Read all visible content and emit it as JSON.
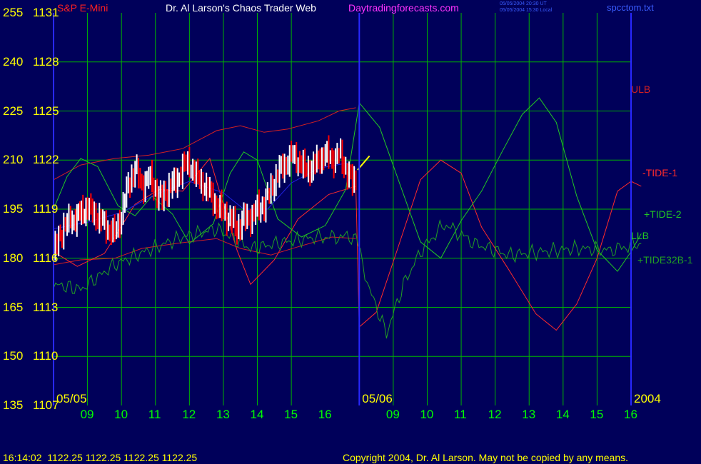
{
  "header": {
    "instrument": "S&P E-Mini",
    "title": "Dr. Al Larson's Chaos Trader Web",
    "website": "Daytradingforecasts.com",
    "stamp_ut": "05/05/2004 20:30 UT",
    "stamp_local": "05/05/2004 15:30 Local",
    "file": "spcctom.txt"
  },
  "colors": {
    "background": "#00005a",
    "grid": "#00b400",
    "axis": "#2828ff",
    "price_up": "#ffffff",
    "price_down": "#ff0000",
    "ulb_llb": "#d42020",
    "tide1": "#ff2a2a",
    "tide2": "#22c822",
    "tide32b1": "#22a022",
    "moving_avg": "#2020e0",
    "axis_text": "#ffff00",
    "date_text": "#00ff00",
    "title_text": "#ffffff",
    "website_text": "#ff33ff"
  },
  "footer": {
    "quote": "16:14:02  1122.25 1122.25 1122.25 1122.25",
    "copyright": "Copyright 2004, Dr. Al Larson. May not be copied by any means."
  },
  "chart_data": {
    "type": "line",
    "title": "Dr. Al Larson's Chaos Trader Web",
    "y_left_labels": [
      "255",
      "240",
      "225",
      "210",
      "195",
      "180",
      "165",
      "150",
      "135"
    ],
    "y_price_labels": [
      "1131",
      "1128",
      "1125",
      "1122",
      "1119",
      "1116",
      "1113",
      "1110",
      "1107"
    ],
    "ylim": [
      1107,
      1131
    ],
    "x_date_labels": [
      {
        "label": "05/05",
        "at": 7
      },
      {
        "label": "05/06",
        "at": 16
      },
      {
        "label": "2004",
        "at": 24
      }
    ],
    "x_ticks": [
      "09",
      "10",
      "11",
      "12",
      "13",
      "14",
      "15",
      "16",
      "09",
      "10",
      "11",
      "12",
      "13",
      "14",
      "15",
      "16"
    ],
    "xlim": [
      7,
      24
    ],
    "series": [
      {
        "name": "ULB",
        "role": "band",
        "points": [
          [
            7,
            1120.8
          ],
          [
            7.8,
            1121.7
          ],
          [
            8.8,
            1122.1
          ],
          [
            9.8,
            1122.3
          ],
          [
            10.8,
            1122.7
          ],
          [
            11.8,
            1123.8
          ],
          [
            12.5,
            1124.1
          ],
          [
            13.2,
            1123.7
          ],
          [
            13.9,
            1123.9
          ],
          [
            14.8,
            1124.4
          ],
          [
            15.4,
            1125.0
          ],
          [
            15.9,
            1125.2
          ]
        ]
      },
      {
        "name": "LLB",
        "role": "band",
        "points": [
          [
            7,
            1115.6
          ],
          [
            7.8,
            1115.9
          ],
          [
            8.8,
            1116.0
          ],
          [
            9.6,
            1116.6
          ],
          [
            10.6,
            1116.9
          ],
          [
            11.8,
            1117.2
          ],
          [
            12.5,
            1116.6
          ],
          [
            13.4,
            1116.2
          ],
          [
            14.2,
            1116.7
          ],
          [
            15.2,
            1117.3
          ],
          [
            15.9,
            1117.2
          ]
        ]
      },
      {
        "name": "-TIDE-1",
        "role": "cycle",
        "points": [
          [
            7,
            1116.4
          ],
          [
            7.7,
            1115.5
          ],
          [
            8.5,
            1116.3
          ],
          [
            9.4,
            1119.3
          ],
          [
            10.1,
            1120.2
          ],
          [
            10.8,
            1120.1
          ],
          [
            11.6,
            1122.1
          ],
          [
            12.4,
            1116.5
          ],
          [
            12.8,
            1114.4
          ],
          [
            13.5,
            1115.9
          ],
          [
            14.2,
            1118.4
          ],
          [
            15.1,
            1119.9
          ],
          [
            15.9,
            1120.4
          ],
          [
            16.0,
            1111.8
          ],
          [
            16.5,
            1112.7
          ],
          [
            17.1,
            1116.4
          ],
          [
            17.8,
            1120.8
          ],
          [
            18.4,
            1122.0
          ],
          [
            19.0,
            1121.2
          ],
          [
            19.6,
            1117.9
          ],
          [
            20.4,
            1115.3
          ],
          [
            21.2,
            1112.6
          ],
          [
            21.8,
            1111.6
          ],
          [
            22.4,
            1113.2
          ],
          [
            23.0,
            1116.0
          ],
          [
            23.6,
            1120.1
          ],
          [
            24.0,
            1120.7
          ],
          [
            24.3,
            1120.4
          ]
        ]
      },
      {
        "name": "+TIDE-2",
        "role": "cycle",
        "points": [
          [
            7,
            1119.0
          ],
          [
            7.4,
            1121.0
          ],
          [
            7.8,
            1122.1
          ],
          [
            8.3,
            1121.6
          ],
          [
            8.9,
            1119.2
          ],
          [
            9.4,
            1118.6
          ],
          [
            9.9,
            1119.8
          ],
          [
            10.5,
            1118.7
          ],
          [
            11.0,
            1116.9
          ],
          [
            11.7,
            1118.1
          ],
          [
            12.2,
            1121.2
          ],
          [
            12.6,
            1122.5
          ],
          [
            13.0,
            1122.0
          ],
          [
            13.6,
            1118.4
          ],
          [
            14.3,
            1117.3
          ],
          [
            15.0,
            1118.0
          ],
          [
            15.6,
            1120.2
          ],
          [
            16.0,
            1125.5
          ],
          [
            16.6,
            1124.0
          ],
          [
            17.2,
            1120.5
          ],
          [
            17.8,
            1117.0
          ],
          [
            18.4,
            1116.0
          ],
          [
            19.0,
            1118.3
          ],
          [
            19.6,
            1120.1
          ],
          [
            20.2,
            1122.5
          ],
          [
            20.8,
            1124.8
          ],
          [
            21.3,
            1125.8
          ],
          [
            21.8,
            1124.3
          ],
          [
            22.4,
            1119.8
          ],
          [
            23.0,
            1116.5
          ],
          [
            23.6,
            1115.2
          ],
          [
            24.0,
            1116.4
          ],
          [
            24.3,
            1117.5
          ]
        ]
      },
      {
        "name": "+TIDE32B-1",
        "role": "cycle",
        "points": [
          [
            7,
            1114.4
          ],
          [
            7.8,
            1114.1
          ],
          [
            8.8,
            1115.6
          ],
          [
            9.8,
            1116.5
          ],
          [
            10.8,
            1117.3
          ],
          [
            11.8,
            1117.8
          ],
          [
            12.8,
            1116.6
          ],
          [
            13.8,
            1117.0
          ],
          [
            14.8,
            1117.3
          ],
          [
            15.9,
            1117.3
          ],
          [
            16.3,
            1114.1
          ],
          [
            16.8,
            1111.4
          ],
          [
            17.3,
            1114.4
          ],
          [
            17.8,
            1116.4
          ],
          [
            18.5,
            1118.1
          ],
          [
            19.4,
            1116.9
          ],
          [
            20.4,
            1116.2
          ],
          [
            21.4,
            1116.4
          ],
          [
            22.4,
            1116.6
          ],
          [
            23.4,
            1116.5
          ],
          [
            24.3,
            1116.9
          ]
        ]
      },
      {
        "name": "",
        "role": "moving-average",
        "points": [
          [
            7,
            1117.8
          ],
          [
            8.0,
            1118.2
          ],
          [
            9.0,
            1118.8
          ],
          [
            10.0,
            1119.9
          ],
          [
            11.0,
            1120.7
          ],
          [
            12.0,
            1120.0
          ],
          [
            12.6,
            1119.0
          ],
          [
            13.3,
            1119.0
          ],
          [
            14.0,
            1120.6
          ],
          [
            14.8,
            1121.5
          ],
          [
            15.6,
            1121.8
          ],
          [
            15.9,
            1121.5
          ]
        ]
      },
      {
        "name": "",
        "role": "price-close",
        "points": [
          [
            7,
            1116.3
          ],
          [
            7.3,
            1118.0
          ],
          [
            7.6,
            1118.4
          ],
          [
            8.0,
            1119.1
          ],
          [
            8.3,
            1118.5
          ],
          [
            8.6,
            1117.8
          ],
          [
            8.8,
            1117.5
          ],
          [
            9.0,
            1118.7
          ],
          [
            9.2,
            1120.5
          ],
          [
            9.4,
            1121.5
          ],
          [
            9.6,
            1120.4
          ],
          [
            9.8,
            1121.0
          ],
          [
            10.0,
            1120.2
          ],
          [
            10.2,
            1119.6
          ],
          [
            10.4,
            1120.4
          ],
          [
            10.6,
            1120.6
          ],
          [
            10.8,
            1121.6
          ],
          [
            11.0,
            1121.8
          ],
          [
            11.2,
            1121.0
          ],
          [
            11.4,
            1120.5
          ],
          [
            11.6,
            1120.0
          ],
          [
            11.8,
            1119.2
          ],
          [
            12.0,
            1118.8
          ],
          [
            12.2,
            1118.4
          ],
          [
            12.4,
            1117.8
          ],
          [
            12.6,
            1118.4
          ],
          [
            12.8,
            1118.5
          ],
          [
            13.0,
            1119.0
          ],
          [
            13.2,
            1119.3
          ],
          [
            13.4,
            1120.2
          ],
          [
            13.6,
            1121.2
          ],
          [
            13.8,
            1121.7
          ],
          [
            14.0,
            1122.3
          ],
          [
            14.2,
            1122.0
          ],
          [
            14.4,
            1121.4
          ],
          [
            14.6,
            1121.5
          ],
          [
            14.8,
            1122.0
          ],
          [
            15.0,
            1122.4
          ],
          [
            15.2,
            1122.0
          ],
          [
            15.4,
            1122.4
          ],
          [
            15.6,
            1121.5
          ],
          [
            15.8,
            1120.6
          ],
          [
            15.95,
            1121.0
          ]
        ]
      },
      {
        "name": "",
        "role": "projection",
        "points": [
          [
            15.95,
            1121.4
          ],
          [
            16.3,
            1122.25
          ]
        ]
      }
    ],
    "last_price": 1122.25
  }
}
